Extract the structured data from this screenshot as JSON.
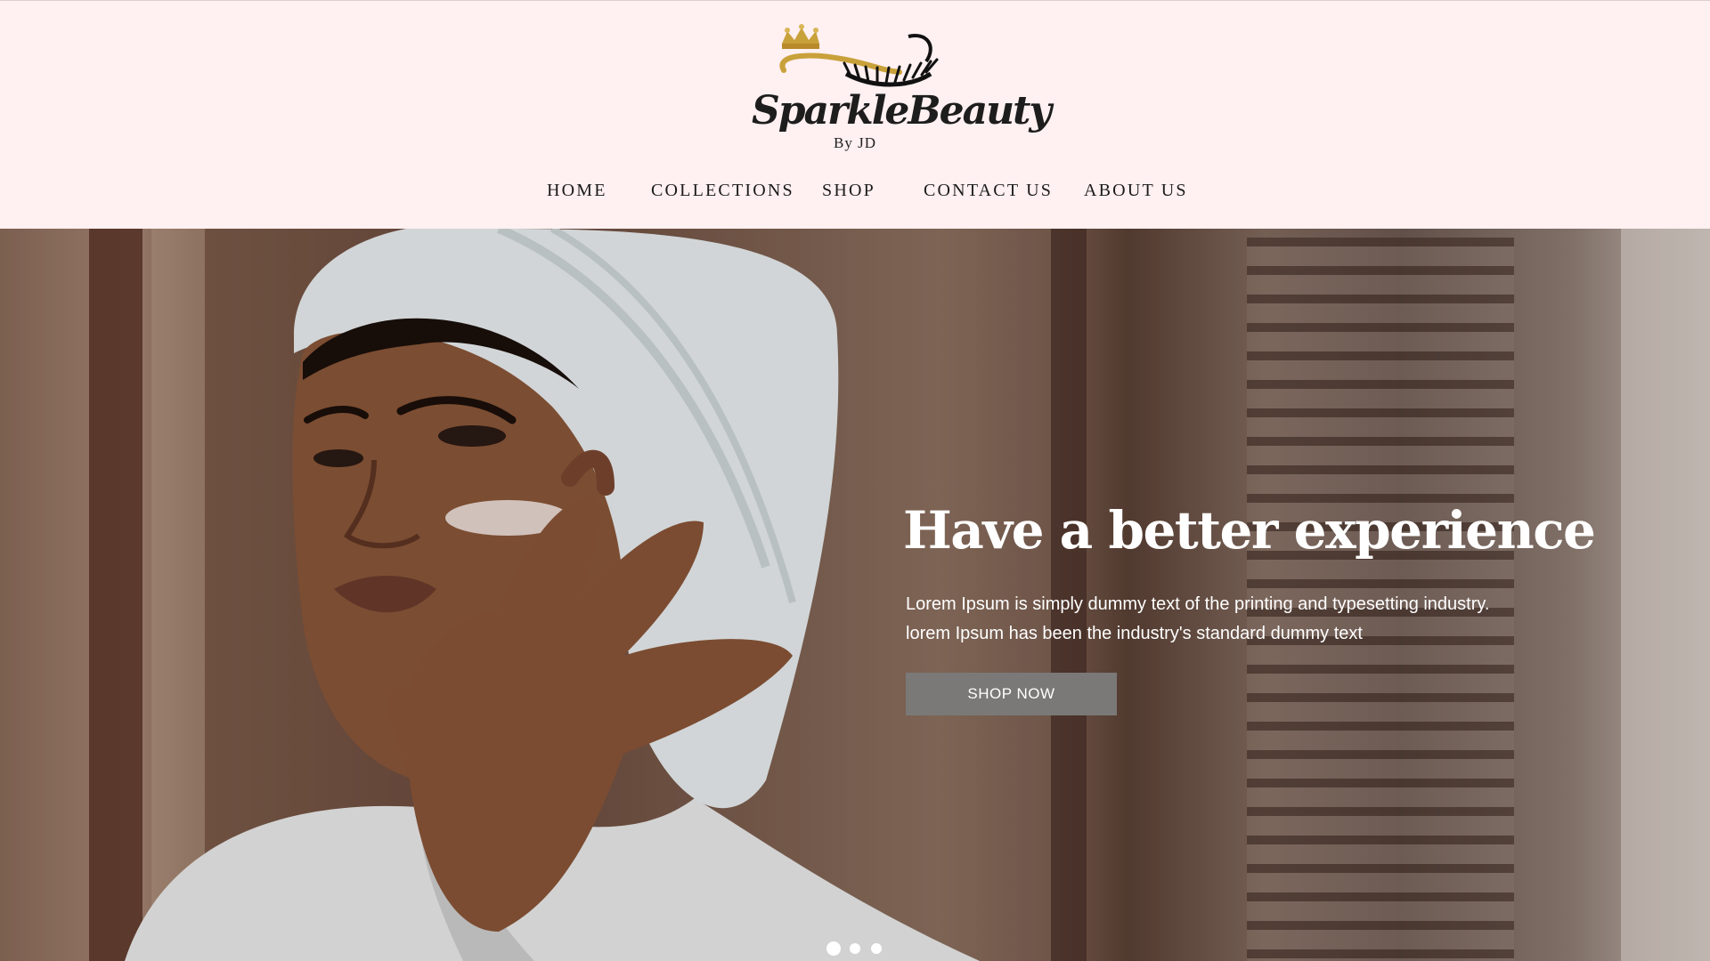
{
  "brand": {
    "script_name": "SparkleBeauty",
    "byline": "By JD"
  },
  "nav": {
    "items": [
      {
        "label": "HOME"
      },
      {
        "label": "COLLECTIONS"
      },
      {
        "label": "SHOP"
      },
      {
        "label": "CONTACT US"
      },
      {
        "label": "ABOUT US"
      }
    ]
  },
  "hero": {
    "title": "Have a better experience",
    "text_line_1": "Lorem Ipsum is simply dummy text of the printing and typesetting industry.",
    "text_line_2": "lorem Ipsum has been the industry's standard dummy text",
    "cta_label": "SHOP NOW",
    "slides": {
      "count": 3,
      "active_index": 1
    }
  },
  "colors": {
    "header_bg": "#fff0f1",
    "nav_text": "#1b1b1b",
    "logo_gold": "#c9a13b",
    "cta_bg": "#7b7978",
    "hero_text": "#ffffff"
  },
  "icons": [
    "crown-icon",
    "eyelash-icon"
  ]
}
